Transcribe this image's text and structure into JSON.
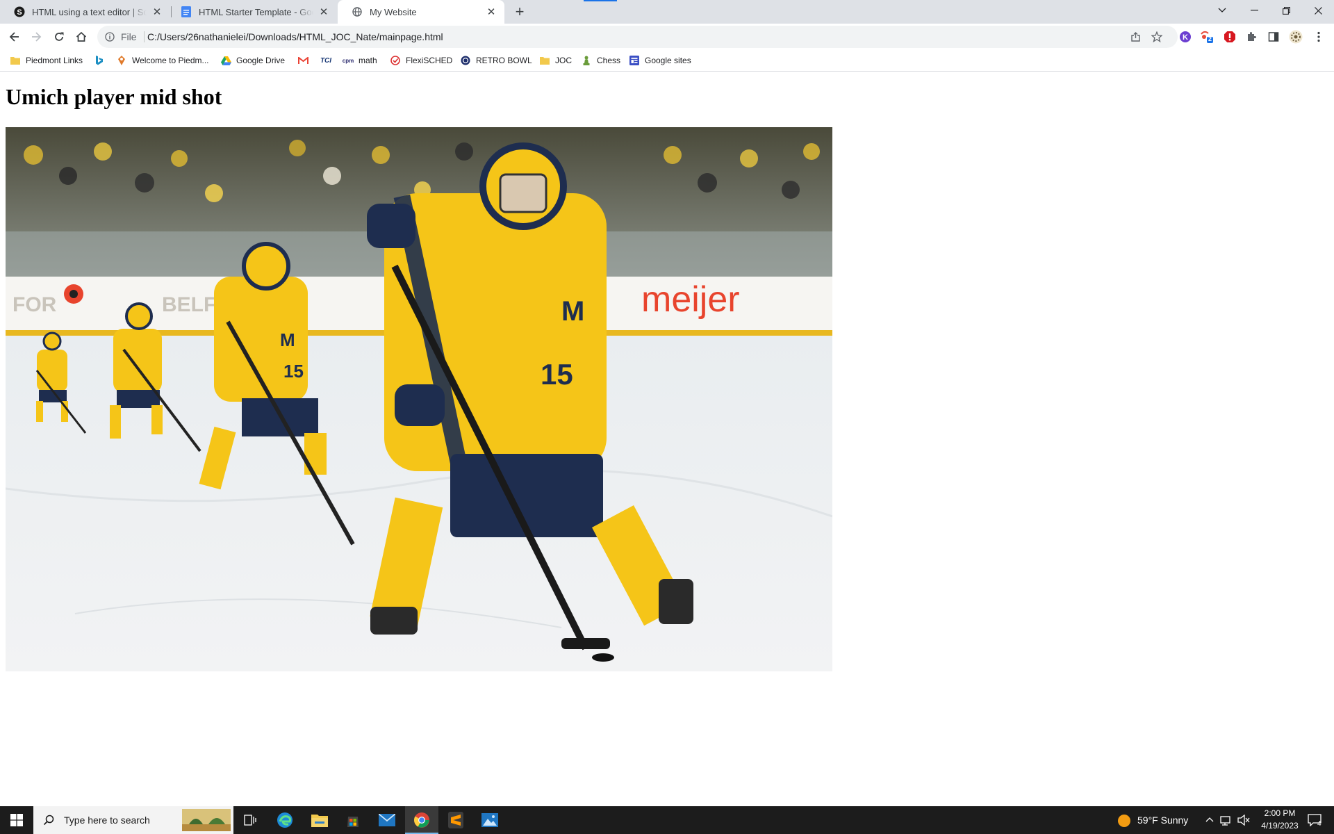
{
  "browser": {
    "tabs": [
      {
        "title": "HTML using a text editor | Schoo",
        "icon": "schoology-icon",
        "active": false
      },
      {
        "title": "HTML Starter Template - Google",
        "icon": "google-docs-icon",
        "active": false
      },
      {
        "title": "My Website",
        "icon": "globe-icon",
        "active": true
      }
    ],
    "address": {
      "scheme_label": "File",
      "url": "C:/Users/26nathanielei/Downloads/HTML_JOC_Nate/mainpage.html"
    },
    "extension_badge": "2",
    "bookmarks": [
      {
        "label": "Piedmont Links",
        "icon": "folder-icon"
      },
      {
        "label": "",
        "icon": "bing-icon"
      },
      {
        "label": "Welcome to Piedm...",
        "icon": "location-icon"
      },
      {
        "label": "Google Drive",
        "icon": "google-drive-icon"
      },
      {
        "label": "",
        "icon": "gmail-icon"
      },
      {
        "label": "",
        "icon": "tci-icon"
      },
      {
        "label": "math",
        "icon": "cpm-icon"
      },
      {
        "label": "FlexiSCHED",
        "icon": "flexisched-icon"
      },
      {
        "label": "RETRO BOWL",
        "icon": "retro-bowl-icon"
      },
      {
        "label": "JOC",
        "icon": "folder-icon"
      },
      {
        "label": "Chess",
        "icon": "chess-pawn-icon"
      },
      {
        "label": "Google sites",
        "icon": "google-sites-icon"
      }
    ]
  },
  "page": {
    "heading": "Umich player mid shot",
    "image": {
      "description_icon": "hockey-photo",
      "jersey_number": "15",
      "jersey_letter": "M",
      "ad_text": "meijer",
      "ad_text_left": "FOR",
      "ad_text_mid": "BELF"
    }
  },
  "taskbar": {
    "search_placeholder": "Type here to search",
    "weather": "59°F  Sunny",
    "time": "2:00 PM",
    "date": "4/19/2023",
    "notification_count": "4"
  },
  "colors": {
    "tabstrip": "#dee1e6",
    "accent": "#1a73e8",
    "jersey_yellow": "#f5c518",
    "jersey_navy": "#1e2d4f",
    "ad_red": "#e8442d"
  }
}
